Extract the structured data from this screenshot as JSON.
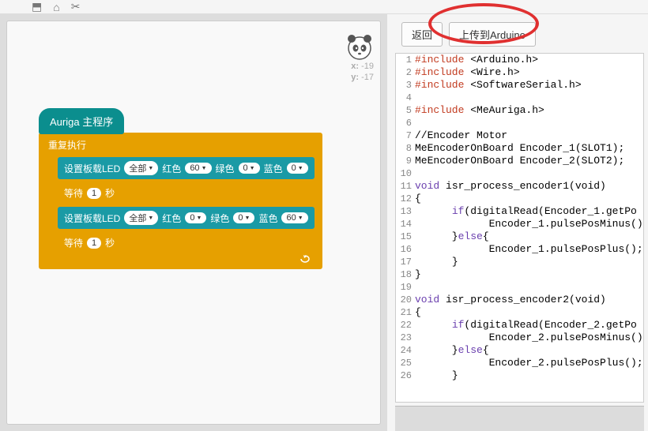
{
  "topbar": {
    "icons": [
      "⬒",
      "⌂",
      "✂"
    ]
  },
  "coords": {
    "x_label": "x:",
    "x_val": "-19",
    "y_label": "y:",
    "y_val": "-17"
  },
  "hat": "Auriga 主程序",
  "loop_label": "重复执行",
  "stmt1": {
    "prefix": "设置板载LED",
    "port": "全部",
    "r_lbl": "红色",
    "r_val": "60",
    "g_lbl": "绿色",
    "g_val": "0",
    "b_lbl": "蓝色",
    "b_val": "0"
  },
  "wait1": {
    "prefix": "等待",
    "val": "1",
    "suffix": "秒"
  },
  "stmt2": {
    "prefix": "设置板载LED",
    "port": "全部",
    "r_lbl": "红色",
    "r_val": "0",
    "g_lbl": "绿色",
    "g_val": "0",
    "b_lbl": "蓝色",
    "b_val": "60"
  },
  "wait2": {
    "prefix": "等待",
    "val": "1",
    "suffix": "秒"
  },
  "buttons": {
    "back": "返回",
    "upload": "上传到Arduino"
  },
  "code": [
    {
      "ln": 1,
      "pre": "",
      "kw": "#include",
      "rest": " <Arduino.h>"
    },
    {
      "ln": 2,
      "pre": "",
      "kw": "#include",
      "rest": " <Wire.h>"
    },
    {
      "ln": 3,
      "pre": "",
      "kw": "#include",
      "rest": " <SoftwareSerial.h>"
    },
    {
      "ln": 4,
      "pre": "",
      "kw": "",
      "rest": ""
    },
    {
      "ln": 5,
      "pre": "",
      "kw": "#include",
      "rest": " <MeAuriga.h>"
    },
    {
      "ln": 6,
      "pre": "",
      "kw": "",
      "rest": ""
    },
    {
      "ln": 7,
      "pre": "",
      "kw": "",
      "rest": "//Encoder Motor"
    },
    {
      "ln": 8,
      "pre": "",
      "kw": "",
      "rest": "MeEncoderOnBoard Encoder_1(SLOT1);"
    },
    {
      "ln": 9,
      "pre": "",
      "kw": "",
      "rest": "MeEncoderOnBoard Encoder_2(SLOT2);"
    },
    {
      "ln": 10,
      "pre": "",
      "kw": "",
      "rest": ""
    },
    {
      "ln": 11,
      "pre": "",
      "kw": "void",
      "rest": " isr_process_encoder1(void)"
    },
    {
      "ln": 12,
      "pre": "",
      "kw": "",
      "rest": "{"
    },
    {
      "ln": 13,
      "pre": "      ",
      "kw": "if",
      "rest": "(digitalRead(Encoder_1.getPo"
    },
    {
      "ln": 14,
      "pre": "            ",
      "kw": "",
      "rest": "Encoder_1.pulsePosMinus()"
    },
    {
      "ln": 15,
      "pre": "      }",
      "kw": "else",
      "rest": "{"
    },
    {
      "ln": 16,
      "pre": "            ",
      "kw": "",
      "rest": "Encoder_1.pulsePosPlus();"
    },
    {
      "ln": 17,
      "pre": "      ",
      "kw": "",
      "rest": "}"
    },
    {
      "ln": 18,
      "pre": "",
      "kw": "",
      "rest": "}"
    },
    {
      "ln": 19,
      "pre": "",
      "kw": "",
      "rest": ""
    },
    {
      "ln": 20,
      "pre": "",
      "kw": "void",
      "rest": " isr_process_encoder2(void)"
    },
    {
      "ln": 21,
      "pre": "",
      "kw": "",
      "rest": "{"
    },
    {
      "ln": 22,
      "pre": "      ",
      "kw": "if",
      "rest": "(digitalRead(Encoder_2.getPo"
    },
    {
      "ln": 23,
      "pre": "            ",
      "kw": "",
      "rest": "Encoder_2.pulsePosMinus()"
    },
    {
      "ln": 24,
      "pre": "      }",
      "kw": "else",
      "rest": "{"
    },
    {
      "ln": 25,
      "pre": "            ",
      "kw": "",
      "rest": "Encoder_2.pulsePosPlus();"
    },
    {
      "ln": 26,
      "pre": "      ",
      "kw": "",
      "rest": "}"
    }
  ]
}
